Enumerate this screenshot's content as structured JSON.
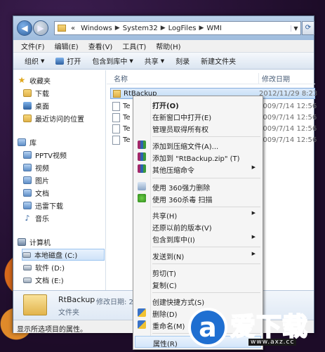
{
  "address": {
    "prefix": "«",
    "crumbs": [
      "Windows",
      "System32",
      "LogFiles",
      "WMI"
    ],
    "separator": "▶"
  },
  "menubar": [
    "文件(F)",
    "编辑(E)",
    "查看(V)",
    "工具(T)",
    "帮助(H)"
  ],
  "toolbar": {
    "organize": "组织",
    "open": "打开",
    "include_library": "包含到库中",
    "share": "共享",
    "burn": "刻录",
    "new_folder": "新建文件夹"
  },
  "nav": {
    "favorites": "收藏夹",
    "downloads": "下载",
    "desktop": "桌面",
    "recent": "最近访问的位置",
    "libraries": "库",
    "pptv": "PPTV视频",
    "videos": "视频",
    "pictures": "图片",
    "documents": "文档",
    "xunlei": "迅雷下载",
    "music": "音乐",
    "computer": "计算机",
    "local_c": "本地磁盘 (C:)",
    "soft_d": "软件 (D:)",
    "doc_e": "文档 (E:)"
  },
  "columns": {
    "name": "名称",
    "modified": "修改日期"
  },
  "files": [
    {
      "name": "RtBackup",
      "date": "2012/11/29 8:23",
      "folder": true
    },
    {
      "name": "Te",
      "date": "2009/7/14 12:56",
      "folder": false
    },
    {
      "name": "Te",
      "date": "2009/7/14 12:56",
      "folder": false
    },
    {
      "name": "Te",
      "date": "2009/7/14 12:56",
      "folder": false
    },
    {
      "name": "Te",
      "date": "2009/7/14 12:56",
      "folder": false
    }
  ],
  "details": {
    "name": "RtBackup",
    "modified": "修改日期: 2012",
    "type": "文件夹"
  },
  "status": "显示所选项目的属性。",
  "context_menu": {
    "open": "打开(O)",
    "open_new_window": "在新窗口中打开(E)",
    "take_ownership": "管理员取得所有权",
    "add_archive": "添加到压缩文件(A)...",
    "add_zip": "添加到 \"RtBackup.zip\" (T)",
    "other_compress": "其他压缩命令",
    "force_delete_360": "使用 360强力删除",
    "scan_360": "使用 360杀毒 扫描",
    "share": "共享(H)",
    "restore_prev": "还原以前的版本(V)",
    "include_library": "包含到库中(I)",
    "send_to": "发送到(N)",
    "cut": "剪切(T)",
    "copy": "复制(C)",
    "create_shortcut": "创建快捷方式(S)",
    "delete": "删除(D)",
    "rename": "重命名(M)",
    "properties": "属性(R)",
    "submenu_arrow": "▶"
  },
  "watermark": {
    "glyph": "a",
    "text": "爱下载",
    "url": "www.axz.cc"
  }
}
